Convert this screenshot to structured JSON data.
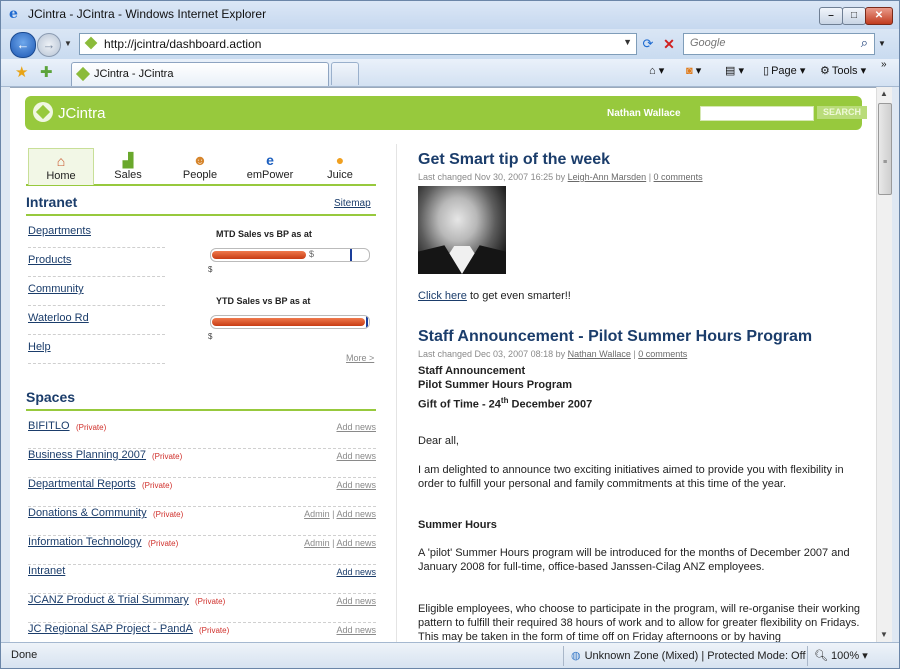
{
  "window": {
    "title": "JCintra - JCintra - Windows Internet Explorer"
  },
  "address": {
    "url": "http://jcintra/dashboard.action",
    "search_placeholder": "Google"
  },
  "tab": {
    "label": "JCintra - JCintra"
  },
  "commands": {
    "page": "Page",
    "tools": "Tools"
  },
  "header": {
    "brand": "JCintra",
    "user": "Nathan Wallace",
    "search_button": "SEARCH"
  },
  "top_tabs": [
    {
      "label": "Home",
      "icon": "house-icon"
    },
    {
      "label": "Sales",
      "icon": "chart-icon"
    },
    {
      "label": "People",
      "icon": "people-icon"
    },
    {
      "label": "emPower",
      "icon": "empower-icon"
    },
    {
      "label": "Juice",
      "icon": "orange-icon"
    }
  ],
  "intranet": {
    "heading": "Intranet",
    "sitemap": "Sitemap",
    "links": [
      "Departments",
      "Products",
      "Community",
      "Waterloo Rd",
      "Help"
    ],
    "mtd_label": "MTD Sales vs BP as at",
    "ytd_label": "YTD Sales vs BP as at",
    "mtd_progress": 0.6,
    "ytd_progress": 0.98,
    "currency": "$",
    "more": "More >"
  },
  "spaces": {
    "heading": "Spaces",
    "items": [
      {
        "name": "BIFITLO",
        "private": "(Private)",
        "admin": "",
        "add": "Add news"
      },
      {
        "name": "Business Planning 2007",
        "private": "(Private)",
        "admin": "",
        "add": "Add news"
      },
      {
        "name": "Departmental Reports",
        "private": "(Private)",
        "admin": "",
        "add": "Add news"
      },
      {
        "name": "Donations & Community",
        "private": "(Private)",
        "admin": "Admin",
        "add": "Add news"
      },
      {
        "name": "Information Technology",
        "private": "(Private)",
        "admin": "Admin",
        "add": "Add news"
      },
      {
        "name": "Intranet",
        "private": "",
        "admin": "",
        "add": "Add news"
      },
      {
        "name": "JCANZ Product & Trial Summary",
        "private": "(Private)",
        "admin": "",
        "add": "Add news"
      },
      {
        "name": "JC Regional SAP Project - PandA",
        "private": "(Private)",
        "admin": "",
        "add": "Add news"
      }
    ]
  },
  "posts": {
    "tip": {
      "title": "Get Smart tip of the week",
      "meta_prefix": "Last changed Nov 30, 2007 16:25 by",
      "author": "Leigh-Ann Marsden",
      "comments": "0 comments",
      "click_here": "Click here",
      "click_rest": "to get even smarter!!"
    },
    "announcement": {
      "title": "Staff Announcement - Pilot Summer Hours Program",
      "meta_prefix": "Last changed Dec 03, 2007 08:18 by",
      "author": "Nathan Wallace",
      "comments": "0 comments",
      "line1": "Staff Announcement",
      "line2": "Pilot Summer Hours Program",
      "line3_a": "Gift of Time - 24",
      "line3_sup": "th",
      "line3_b": "December 2007",
      "greeting": "Dear all,",
      "para1": "I am delighted to announce two exciting initiatives aimed to provide you with flexibility in order to fulfill your personal and family commitments at this time of the year.",
      "subhead": "Summer Hours",
      "para2": "A 'pilot' Summer Hours program will be introduced for the months of December 2007 and January 2008 for full-time, office-based Janssen-Cilag ANZ employees.",
      "para3": "Eligible employees, who choose to participate in the program, will re-organise their working pattern to fulfill their required 38 hours of work and to allow for greater flexibility on Fridays. This may be taken in the form of time off on Friday afternoons or by having"
    }
  },
  "status": {
    "done": "Done",
    "zone": "Unknown Zone (Mixed) | Protected Mode: Off",
    "zoom": "100%"
  }
}
